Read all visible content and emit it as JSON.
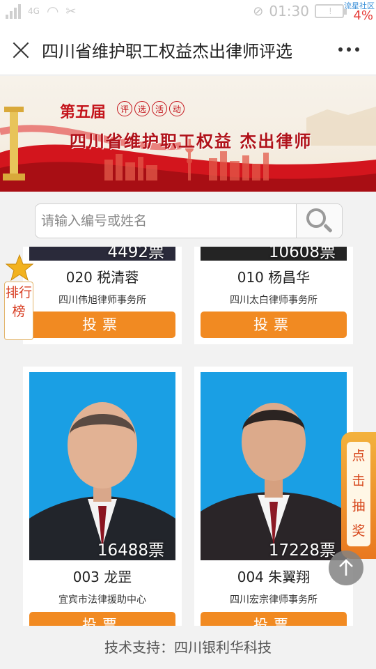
{
  "status_bar": {
    "network": "4G",
    "time": "01:30",
    "battery_percent": "4%",
    "watermark": "流星社区"
  },
  "header": {
    "title": "四川省维护职工权益杰出律师评选"
  },
  "banner": {
    "edition": "第五届",
    "tags": [
      "评",
      "选",
      "活",
      "动"
    ],
    "main_title": "四川省维护职工权益 杰出律师",
    "colors": {
      "red": "#c4141b",
      "cream": "#f7f2ea"
    }
  },
  "search": {
    "placeholder": "请输入编号或姓名",
    "value": ""
  },
  "candidates": [
    {
      "votes": "4492票",
      "name": "020 税清蓉",
      "firm": "四川伟旭律师事务所",
      "vote_label": "投票"
    },
    {
      "votes": "10608票",
      "name": "010 杨昌华",
      "firm": "四川太白律师事务所",
      "vote_label": "投票"
    },
    {
      "votes": "16488票",
      "name": "003 龙罡",
      "firm": "宜宾市法律援助中心",
      "vote_label": "投票"
    },
    {
      "votes": "17228票",
      "name": "004 朱翼翔",
      "firm": "四川宏宗律师事务所",
      "vote_label": "投票"
    }
  ],
  "ranking": {
    "label": "排行榜"
  },
  "lottery": {
    "label": "点击抽奖"
  },
  "footer": {
    "text": "技术支持：四川银利华科技"
  },
  "theme": {
    "vote_button": "#f18a22",
    "photo_bg": "#1a9fe4"
  }
}
